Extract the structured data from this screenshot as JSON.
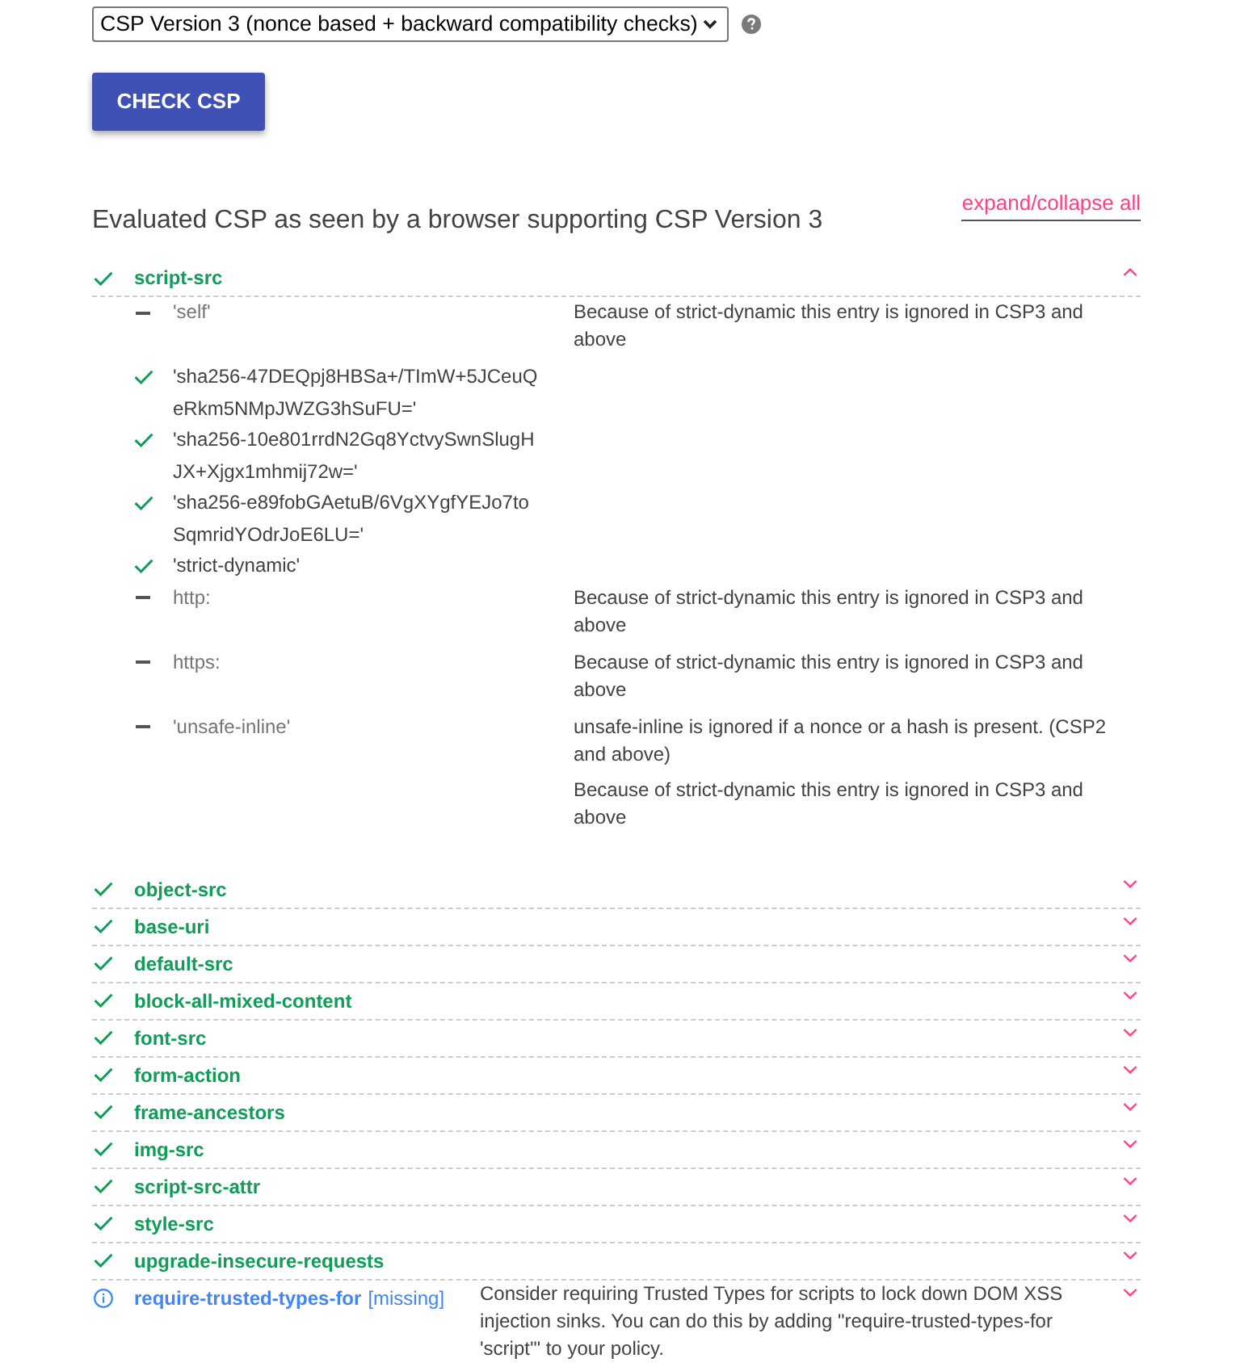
{
  "version_select": {
    "value": "CSP Version 3 (nonce based + backward compatibility checks)"
  },
  "check_button": {
    "label": "CHECK CSP"
  },
  "evaluation": {
    "heading": "Evaluated CSP as seen by a browser supporting CSP Version 3",
    "expand_collapse_link": "expand/collapse all",
    "directives": [
      {
        "name": "script-src",
        "kind": "ok",
        "expanded": true,
        "values": [
          {
            "value": "'self'",
            "kind": "ignored",
            "notes": [
              "Because of strict-dynamic this entry is ignored in CSP3 and above"
            ]
          },
          {
            "value": "'sha256-47DEQpj8HBSa+/TImW+5JCeuQeRkm5NMpJWZG3hSuFU='",
            "kind": "ok"
          },
          {
            "value": "'sha256-10e801rrdN2Gq8YctvySwnSlugHJX+Xjgx1mhmij72w='",
            "kind": "ok"
          },
          {
            "value": "'sha256-e89fobGAetuB/6VgXYgfYEJo7toSqmridYOdrJoE6LU='",
            "kind": "ok"
          },
          {
            "value": "'strict-dynamic'",
            "kind": "ok"
          },
          {
            "value": "http:",
            "kind": "ignored",
            "notes": [
              "Because of strict-dynamic this entry is ignored in CSP3 and above"
            ]
          },
          {
            "value": "https:",
            "kind": "ignored",
            "notes": [
              "Because of strict-dynamic this entry is ignored in CSP3 and above"
            ]
          },
          {
            "value": "'unsafe-inline'",
            "kind": "ignored",
            "notes": [
              "unsafe-inline is ignored if a nonce or a hash is present. (CSP2 and above)",
              "Because of strict-dynamic this entry is ignored in CSP3 and above"
            ]
          }
        ]
      },
      {
        "name": "object-src",
        "kind": "ok",
        "expanded": false
      },
      {
        "name": "base-uri",
        "kind": "ok",
        "expanded": false
      },
      {
        "name": "default-src",
        "kind": "ok",
        "expanded": false
      },
      {
        "name": "block-all-mixed-content",
        "kind": "ok",
        "expanded": false
      },
      {
        "name": "font-src",
        "kind": "ok",
        "expanded": false
      },
      {
        "name": "form-action",
        "kind": "ok",
        "expanded": false
      },
      {
        "name": "frame-ancestors",
        "kind": "ok",
        "expanded": false
      },
      {
        "name": "img-src",
        "kind": "ok",
        "expanded": false
      },
      {
        "name": "script-src-attr",
        "kind": "ok",
        "expanded": false
      },
      {
        "name": "style-src",
        "kind": "ok",
        "expanded": false
      },
      {
        "name": "upgrade-insecure-requests",
        "kind": "ok",
        "expanded": false
      },
      {
        "name": "require-trusted-types-for",
        "kind": "info",
        "tag": "[missing]",
        "expanded": false,
        "notes": [
          "Consider requiring Trusted Types for scripts to lock down DOM XSS injection sinks. You can do this by adding \"require-trusted-types-for 'script'\" to your policy."
        ]
      }
    ]
  }
}
